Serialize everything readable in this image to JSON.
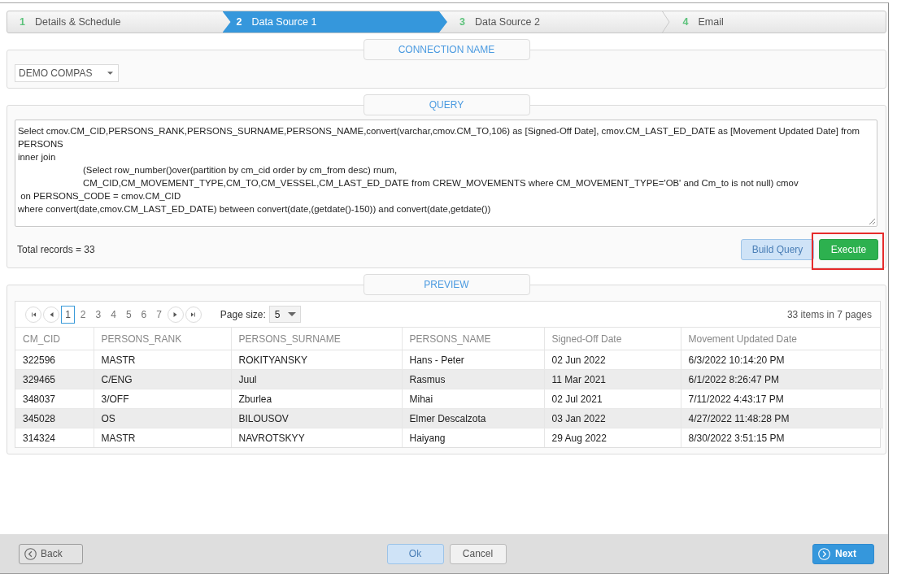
{
  "wizard_steps": [
    {
      "number": "1",
      "label": "Details & Schedule",
      "selected": false
    },
    {
      "number": "2",
      "label": "Data Source 1",
      "selected": true
    },
    {
      "number": "3",
      "label": "Data Source 2",
      "selected": false
    },
    {
      "number": "4",
      "label": "Email",
      "selected": false
    }
  ],
  "connection_section": {
    "title": "CONNECTION NAME",
    "connection_dropdown": {
      "value": "DEMO COMPAS"
    }
  },
  "query_section": {
    "title": "QUERY",
    "query_lines": [
      "Select cmov.CM_CID,PERSONS_RANK,PERSONS_SURNAME,PERSONS_NAME,convert(varchar,cmov.CM_TO,106) as [Signed-Off Date], cmov.CM_LAST_ED_DATE as [Movement Updated Date] from",
      "PERSONS",
      "inner join",
      "\t\t(Select row_number()over(partition by cm_cid order by cm_from desc) rnum,",
      "\t\tCM_CID,CM_MOVEMENT_TYPE,CM_TO,CM_VESSEL,CM_LAST_ED_DATE from CREW_MOVEMENTS where CM_MOVEMENT_TYPE='OB' and Cm_to is not null) cmov",
      " on PERSONS_CODE = cmov.CM_CID",
      "where convert(date,cmov.CM_LAST_ED_DATE) between convert(date,(getdate()-150)) and convert(date,getdate())"
    ],
    "total_records": "Total records = 33",
    "buttons": [
      {
        "label": "Build Query",
        "kind": "build",
        "highlighted": false
      },
      {
        "label": "Execute",
        "kind": "execute",
        "highlighted": true
      }
    ]
  },
  "preview_section": {
    "title": "PREVIEW",
    "pager": {
      "pages": [
        {
          "label": "1",
          "selected": true
        },
        {
          "label": "2",
          "selected": false
        },
        {
          "label": "3",
          "selected": false
        },
        {
          "label": "4",
          "selected": false
        },
        {
          "label": "5",
          "selected": false
        },
        {
          "label": "6",
          "selected": false
        },
        {
          "label": "7",
          "selected": false
        }
      ],
      "page_size_label": "Page size:",
      "page_size": "5",
      "summary": "33 items in 7 pages"
    },
    "table": {
      "columns": [
        "CM_CID",
        "PERSONS_RANK",
        "PERSONS_SURNAME",
        "PERSONS_NAME",
        "Signed-Off Date",
        "Movement Updated Date"
      ],
      "rows": [
        [
          "322596",
          "MASTR",
          "ROKITYANSKY",
          "Hans - Peter",
          "02 Jun 2022",
          "6/3/2022 10:14:20 PM"
        ],
        [
          "329465",
          "C/ENG",
          "Juul",
          "Rasmus",
          "11 Mar 2021",
          "6/1/2022 8:26:47 PM"
        ],
        [
          "348037",
          "3/OFF",
          "Zburlea",
          "Mihai",
          "02 Jul 2021",
          "7/11/2022 4:43:17 PM"
        ],
        [
          "345028",
          "OS",
          "BILOUSOV",
          "Elmer Descalzota",
          "03 Jan 2022",
          "4/27/2022 11:48:28 PM"
        ],
        [
          "314324",
          "MASTR",
          "NAVROTSKYY",
          "Haiyang",
          "29 Aug 2022",
          "8/30/2022 3:51:15 PM"
        ]
      ]
    }
  },
  "footer": {
    "buttons": [
      {
        "label": "Back",
        "kind": "back"
      },
      {
        "label": "Ok",
        "kind": "ok"
      },
      {
        "label": "Cancel",
        "kind": "cancel"
      },
      {
        "label": "Next",
        "kind": "next"
      }
    ]
  }
}
